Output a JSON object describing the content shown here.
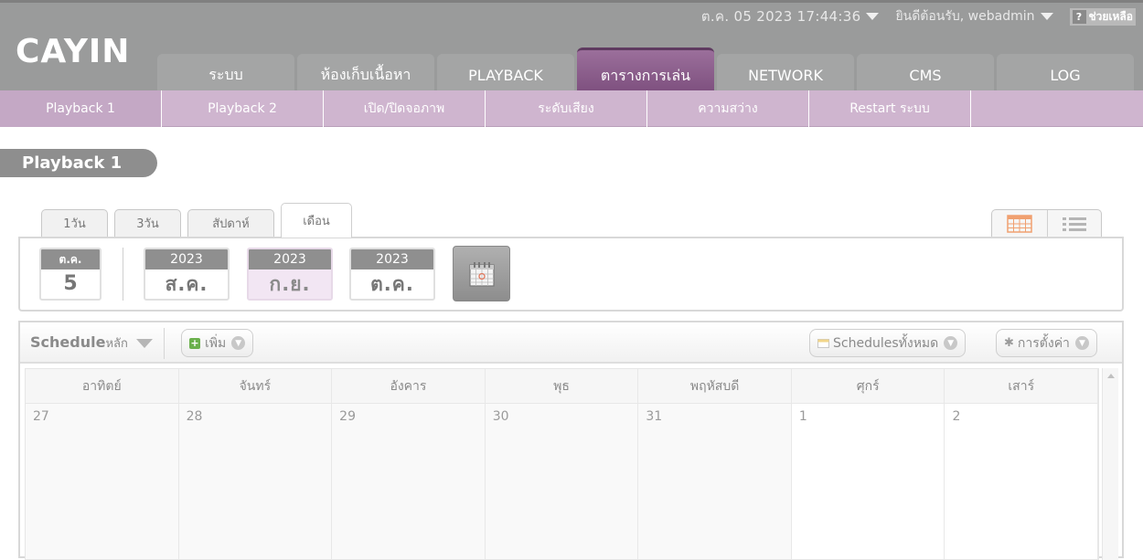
{
  "header": {
    "brand": "CAYIN",
    "datetime": "ต.ค. 05 2023 17:44:36",
    "welcome": "ยินดีต้อนรับ, webadmin",
    "help_label": "ช่วยเหลือ",
    "tabs": [
      {
        "label": "ระบบ"
      },
      {
        "label": "ห้องเก็บเนื้อหา"
      },
      {
        "label": "PLAYBACK"
      },
      {
        "label": "ตารางการเล่น"
      },
      {
        "label": "NETWORK"
      },
      {
        "label": "CMS"
      },
      {
        "label": "LOG"
      }
    ],
    "active_tab": "ตารางการเล่น"
  },
  "subnav": [
    {
      "label": "Playback 1"
    },
    {
      "label": "Playback 2"
    },
    {
      "label": "เปิด/ปิดจอภาพ"
    },
    {
      "label": "ระดับเสียง"
    },
    {
      "label": "ความสว่าง"
    },
    {
      "label": "Restart ระบบ"
    }
  ],
  "page_title": "Playback 1",
  "view_tabs": [
    {
      "label": "1วัน"
    },
    {
      "label": "3วัน"
    },
    {
      "label": "สัปดาห์"
    },
    {
      "label": "เดือน"
    }
  ],
  "active_view": "เดือน",
  "date_selector": {
    "today": {
      "month": "ต.ค.",
      "day": "5"
    },
    "months": [
      {
        "year": "2023",
        "month": "ส.ค."
      },
      {
        "year": "2023",
        "month": "ก.ย."
      },
      {
        "year": "2023",
        "month": "ต.ค."
      }
    ],
    "selected_month": "ก.ย."
  },
  "toolbar": {
    "schedule_label": "Schedule",
    "schedule_suffix": "หลัก",
    "add_label": "เพิ่ม",
    "all_schedules_label": "Schedulesทั้งหมด",
    "settings_label": "การตั้งค่า"
  },
  "calendar": {
    "weekdays": [
      "อาทิตย์",
      "จันทร์",
      "อังคาร",
      "พุธ",
      "พฤหัสบดี",
      "ศุกร์",
      "เสาร์"
    ],
    "first_week": [
      "27",
      "28",
      "29",
      "30",
      "31",
      "1",
      "2"
    ]
  },
  "colors": {
    "header_bg": "#9a9b9b",
    "active_tab": "#7d4f7e",
    "subnav_bg": "#cfb5cf",
    "selected_month_bg": "#f2e6f3"
  }
}
